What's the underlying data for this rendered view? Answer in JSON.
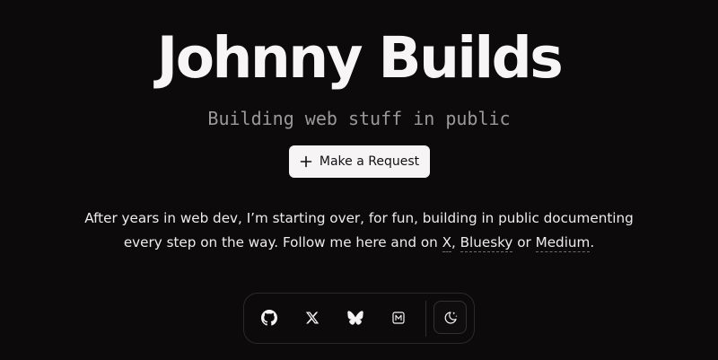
{
  "header": {
    "title": "Johnny Builds",
    "subtitle": "Building web stuff in public"
  },
  "cta": {
    "label": "Make a Request",
    "icon": "plus-icon"
  },
  "intro": {
    "text_before": "After years in web dev, I’m starting over, for fun, building in public documenting every step on the way. Follow me here and on ",
    "link_x": "X",
    "sep1": ", ",
    "link_bluesky": "Bluesky",
    "sep2": " or ",
    "link_medium": "Medium",
    "text_after": "."
  },
  "dock": {
    "items": [
      {
        "name": "github",
        "icon": "github-icon"
      },
      {
        "name": "x",
        "icon": "x-icon"
      },
      {
        "name": "bluesky",
        "icon": "bluesky-icon"
      },
      {
        "name": "medium",
        "icon": "medium-icon"
      }
    ],
    "theme_toggle_icon": "moon-stars-icon"
  },
  "colors": {
    "background": "#0c0a0b",
    "foreground": "#f4f2f3",
    "muted": "#9b999a",
    "button_bg": "#f6f4f5"
  }
}
